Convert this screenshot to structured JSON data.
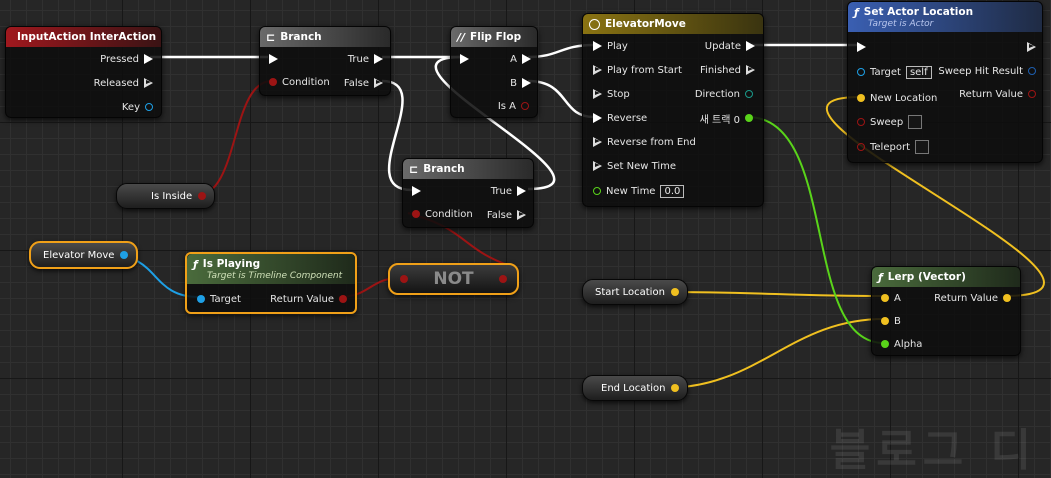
{
  "colors": {
    "exec": "#ffffff",
    "bool": "#9c1414",
    "object": "#1ea0e6",
    "vector": "#f0c020",
    "float": "#59d41a",
    "selection": "#f0a018"
  },
  "nodes": {
    "input_action": {
      "title": "InputAction InterAction",
      "icon": "input-diamond-icon",
      "pins": {
        "pressed": "Pressed",
        "released": "Released",
        "key": "Key"
      }
    },
    "branch1": {
      "title": "Branch",
      "icon": "branch-icon",
      "pins": {
        "true_label": "True",
        "false_label": "False",
        "condition": "Condition"
      }
    },
    "flipflop": {
      "title": "Flip Flop",
      "icon": "flipflop-icon",
      "pins": {
        "a": "A",
        "b": "B",
        "is_a": "Is A"
      }
    },
    "branch2": {
      "title": "Branch",
      "icon": "branch-icon",
      "pins": {
        "true_label": "True",
        "false_label": "False",
        "condition": "Condition"
      }
    },
    "timeline": {
      "title": "ElevatorMove",
      "icon": "clock-icon",
      "inputs": [
        "Play",
        "Play from Start",
        "Stop",
        "Reverse",
        "Reverse from End",
        "Set New Time"
      ],
      "new_time_label": "New Time",
      "new_time_value": "0.0",
      "outputs": {
        "update": "Update",
        "finished": "Finished",
        "direction": "Direction",
        "track": "새 트랙 0"
      }
    },
    "set_actor_location": {
      "title": "Set Actor Location",
      "subtitle": "Target is Actor",
      "icon": "function-icon",
      "pins": {
        "target": "Target",
        "target_value": "self",
        "new_location": "New Location",
        "sweep": "Sweep",
        "teleport": "Teleport",
        "sweep_hit_result": "Sweep Hit Result",
        "return_value": "Return Value"
      }
    },
    "is_playing": {
      "title": "Is Playing",
      "subtitle": "Target is Timeline Component",
      "icon": "function-icon",
      "pins": {
        "target": "Target",
        "return_value": "Return Value"
      }
    },
    "not_node": {
      "label": "NOT"
    },
    "lerp": {
      "title": "Lerp (Vector)",
      "icon": "function-icon",
      "pins": {
        "a": "A",
        "b": "B",
        "alpha": "Alpha",
        "return_value": "Return Value"
      }
    }
  },
  "variables": {
    "is_inside": "Is Inside",
    "elevator_move": "Elevator Move",
    "start_location": "Start Location",
    "end_location": "End Location"
  },
  "watermark": "블로그 디"
}
